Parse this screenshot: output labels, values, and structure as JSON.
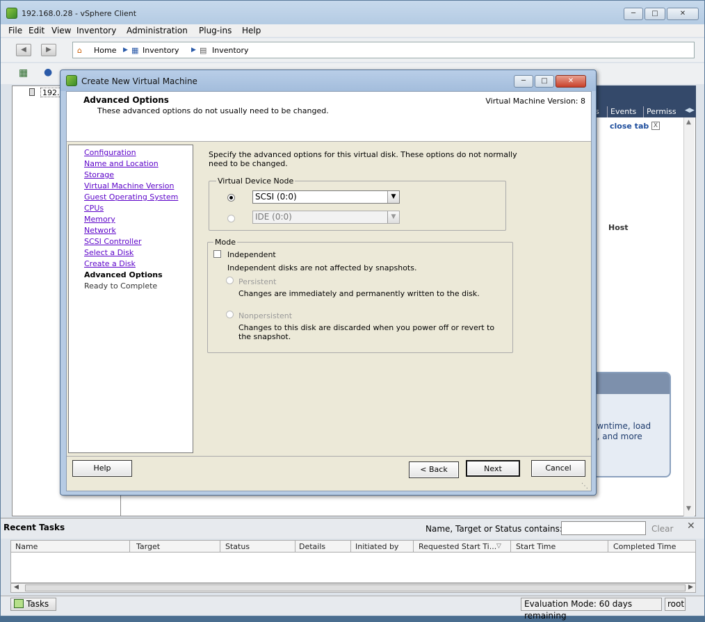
{
  "main_window": {
    "title": "192.168.0.28 - vSphere Client",
    "menu": [
      "File",
      "Edit",
      "View",
      "Inventory",
      "Administration",
      "Plug-ins",
      "Help"
    ],
    "breadcrumb": [
      "Home",
      "Inventory",
      "Inventory"
    ],
    "tree_root_label": "192.",
    "tabs": [
      "s",
      "Events",
      "Permiss"
    ],
    "close_tab_label": "close tab",
    "close_tab_x": "X",
    "host_label": "Host",
    "info_text_1": "owntime, load",
    "info_text_2": "n, and more"
  },
  "dialog": {
    "title": "Create New Virtual Machine",
    "header_title": "Advanced Options",
    "header_subtitle": "These advanced options do not usually need to be changed.",
    "version_text": "Virtual Machine Version: 8",
    "steps": [
      {
        "label": "Configuration",
        "state": "link"
      },
      {
        "label": "Name and Location",
        "state": "link"
      },
      {
        "label": "Storage",
        "state": "link"
      },
      {
        "label": "Virtual Machine Version",
        "state": "link"
      },
      {
        "label": "Guest Operating System",
        "state": "link"
      },
      {
        "label": "CPUs",
        "state": "link"
      },
      {
        "label": "Memory",
        "state": "link"
      },
      {
        "label": "Network",
        "state": "link"
      },
      {
        "label": "SCSI Controller",
        "state": "link"
      },
      {
        "label": "Select a Disk",
        "state": "link"
      },
      {
        "label": "Create a Disk",
        "state": "link"
      },
      {
        "label": "Advanced Options",
        "state": "current"
      },
      {
        "label": "Ready to Complete",
        "state": "future"
      }
    ],
    "intro_text": "Specify the advanced options for this virtual disk. These options do not normally need to be changed.",
    "vdn_legend": "Virtual Device Node",
    "scsi_value": "SCSI (0:0)",
    "ide_value": "IDE (0:0)",
    "mode_legend": "Mode",
    "independent_label": "Independent",
    "independent_desc": "Independent disks are not affected by snapshots.",
    "persistent_label": "Persistent",
    "persistent_desc": "Changes are immediately and permanently written to the disk.",
    "nonpersistent_label": "Nonpersistent",
    "nonpersistent_desc": "Changes to this disk are discarded when you power off or revert to the snapshot.",
    "help_btn": "Help",
    "back_btn": "< Back",
    "next_btn": "Next",
    "cancel_btn": "Cancel"
  },
  "recent_tasks": {
    "title": "Recent Tasks",
    "filter_label": "Name, Target or Status contains: ▾",
    "clear_label": "Clear",
    "close_symbol": "✕",
    "columns": [
      "Name",
      "Target",
      "Status",
      "Details",
      "Initiated by",
      "Requested Start Ti...",
      "Start Time",
      "Completed Time"
    ]
  },
  "status_bar": {
    "tasks_label": "Tasks",
    "eval_text": "Evaluation Mode: 60 days remaining",
    "user_text": "root"
  }
}
